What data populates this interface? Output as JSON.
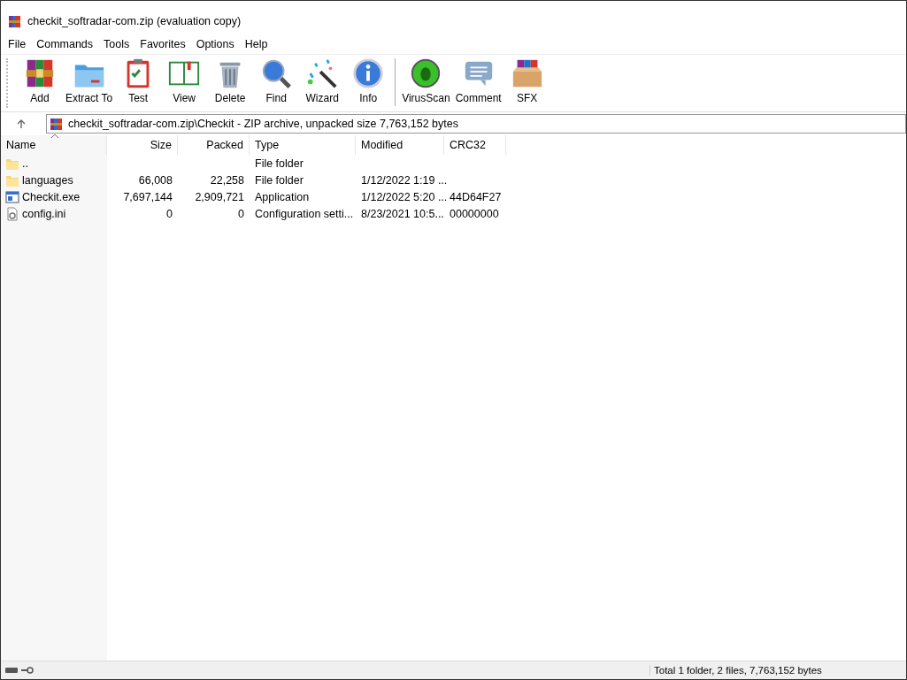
{
  "window": {
    "title": "checkit_softradar-com.zip (evaluation copy)"
  },
  "menu": [
    "File",
    "Commands",
    "Tools",
    "Favorites",
    "Options",
    "Help"
  ],
  "toolbar": {
    "groups": [
      {
        "buttons": [
          {
            "label": "Add",
            "kind": "add"
          },
          {
            "label": "Extract To",
            "kind": "extract"
          },
          {
            "label": "Test",
            "kind": "test"
          },
          {
            "label": "View",
            "kind": "view"
          },
          {
            "label": "Delete",
            "kind": "delete"
          },
          {
            "label": "Find",
            "kind": "find"
          },
          {
            "label": "Wizard",
            "kind": "wizard"
          },
          {
            "label": "Info",
            "kind": "info"
          }
        ]
      },
      {
        "buttons": [
          {
            "label": "VirusScan",
            "kind": "virus"
          },
          {
            "label": "Comment",
            "kind": "comment"
          },
          {
            "label": "SFX",
            "kind": "sfx"
          }
        ]
      }
    ]
  },
  "address": {
    "path": "checkit_softradar-com.zip\\Checkit - ZIP archive, unpacked size 7,763,152 bytes"
  },
  "table": {
    "columns": [
      {
        "label": "Name",
        "sorted": true
      },
      {
        "label": "Size",
        "sorted": false
      },
      {
        "label": "Packed",
        "sorted": false
      },
      {
        "label": "Type",
        "sorted": false
      },
      {
        "label": "Modified",
        "sorted": false
      },
      {
        "label": "CRC32",
        "sorted": false
      }
    ],
    "rows": [
      {
        "kind": "folder",
        "cells": [
          "..",
          "",
          "",
          "File folder",
          "",
          ""
        ]
      },
      {
        "kind": "folder",
        "cells": [
          "languages",
          "66,008",
          "22,258",
          "File folder",
          "1/12/2022 1:19 ...",
          ""
        ]
      },
      {
        "kind": "exe",
        "cells": [
          "Checkit.exe",
          "7,697,144",
          "2,909,721",
          "Application",
          "1/12/2022 5:20 ...",
          "44D64F27"
        ]
      },
      {
        "kind": "ini",
        "cells": [
          "config.ini",
          "0",
          "0",
          "Configuration setti...",
          "8/23/2021 10:5...",
          "00000000"
        ]
      }
    ]
  },
  "status_bar": {
    "text": "Total 1 folder, 2 files, 7,763,152 bytes"
  }
}
